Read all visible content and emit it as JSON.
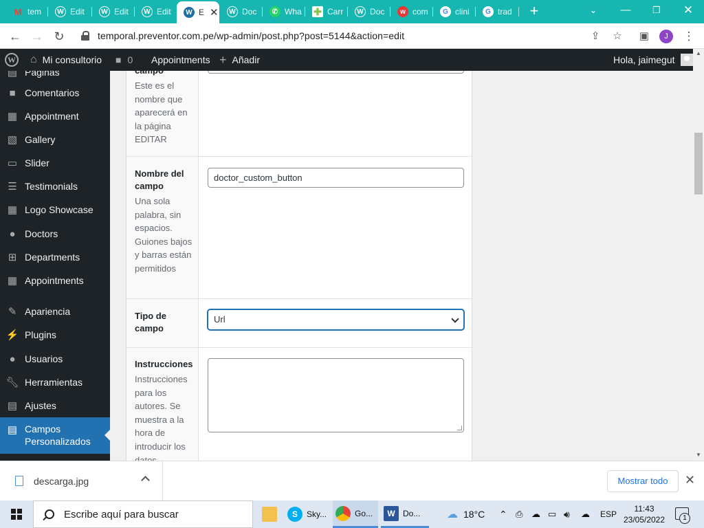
{
  "browser": {
    "tabs": [
      {
        "label": "tem",
        "icon": "gmail-icon",
        "color": "#ea4335"
      },
      {
        "label": "Edit",
        "icon": "wordpress-icon",
        "color": "#ffffff"
      },
      {
        "label": "Edit",
        "icon": "wordpress-icon",
        "color": "#ffffff"
      },
      {
        "label": "Edit",
        "icon": "wordpress-icon",
        "color": "#ffffff"
      },
      {
        "label": "E",
        "icon": "wordpress-icon",
        "color": "#1d6fa5"
      },
      {
        "label": "Doc",
        "icon": "wordpress-icon",
        "color": "#ffffff"
      },
      {
        "label": "Wha",
        "icon": "whatsapp-icon",
        "color": "#25d366"
      },
      {
        "label": "Carr",
        "icon": "plus-cross-icon",
        "color": "#8bc34a"
      },
      {
        "label": "Doc",
        "icon": "wordpress-icon",
        "color": "#ffffff"
      },
      {
        "label": "com",
        "icon": "w-red-icon",
        "color": "#e53935"
      },
      {
        "label": "clini",
        "icon": "google-icon",
        "color": "#4285f4"
      },
      {
        "label": "trad",
        "icon": "google-icon",
        "color": "#4285f4"
      }
    ],
    "new_tab": "+",
    "url": "temporal.preventor.com.pe/wp-admin/post.php?post=5144&action=edit",
    "profile_initial": "J"
  },
  "adminbar": {
    "site_name": "Mi consultorio",
    "comments_count": "0",
    "appointments": "Appointments",
    "add_new": "Añadir",
    "greeting": "Hola, jaimegut"
  },
  "sidebar": {
    "partial_top": "Páginas",
    "items": [
      {
        "label": "Comentarios",
        "icon": "comment-icon"
      },
      {
        "label": "Appointment",
        "icon": "calendar-icon"
      },
      {
        "label": "Gallery",
        "icon": "gallery-icon"
      },
      {
        "label": "Slider",
        "icon": "slider-icon"
      },
      {
        "label": "Testimonials",
        "icon": "testimonial-icon"
      },
      {
        "label": "Logo Showcase",
        "icon": "grid-icon"
      },
      {
        "label": "Doctors",
        "icon": "user-icon"
      },
      {
        "label": "Departments",
        "icon": "sitemap-icon"
      },
      {
        "label": "Appointments",
        "icon": "calendar-icon"
      },
      {
        "label": "Apariencia",
        "icon": "brush-icon"
      },
      {
        "label": "Plugins",
        "icon": "plugin-icon"
      },
      {
        "label": "Usuarios",
        "icon": "user-icon"
      },
      {
        "label": "Herramientas",
        "icon": "wrench-icon"
      },
      {
        "label": "Ajustes",
        "icon": "settings-icon"
      }
    ],
    "current": {
      "label": "Campos Personalizados",
      "icon": "table-icon"
    }
  },
  "form": {
    "row1": {
      "title_partial": "campo",
      "desc": "Este es el nombre que aparecerá en la página EDITAR"
    },
    "row2": {
      "title": "Nombre del campo",
      "desc": "Una sola palabra, sin espacios. Guiones bajos y barras están permitidos",
      "value": "doctor_custom_button"
    },
    "row3": {
      "title": "Tipo de campo",
      "selected": "Url"
    },
    "row4": {
      "title": "Instrucciones",
      "desc": "Instrucciones para los autores. Se muestra a la hora de introducir los datos"
    }
  },
  "downloads": {
    "file": "descarga.jpg",
    "show_all": "Mostrar todo"
  },
  "taskbar": {
    "search_placeholder": "Escribe aquí para buscar",
    "apps": [
      {
        "label": "",
        "icon": "file-explorer-icon"
      },
      {
        "label": "Sky...",
        "icon": "skype-icon"
      },
      {
        "label": "Go...",
        "icon": "chrome-icon"
      },
      {
        "label": "Do...",
        "icon": "word-icon"
      }
    ],
    "weather": "18°C",
    "lang": "ESP",
    "time": "11:43",
    "date": "23/05/2022",
    "notifications": "1"
  }
}
